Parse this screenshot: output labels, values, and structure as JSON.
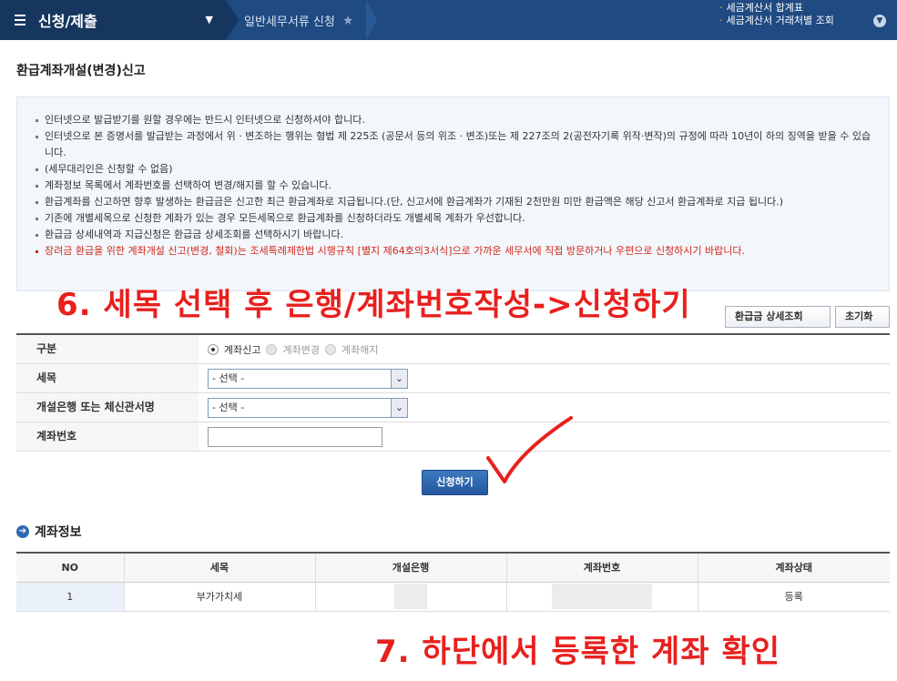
{
  "header": {
    "menu_title": "신청/제출",
    "breadcrumb": "일반세무서류 신청",
    "quicklinks": [
      "세금계산서 합계표",
      "세금계산서 거래처별 조회"
    ]
  },
  "page_title": "환급계좌개설(변경)신고",
  "notices": [
    {
      "text": "인터넷으로 발급받기를 원할 경우에는 반드시 인터넷으로 신청하셔야 합니다.",
      "red": false
    },
    {
      "text": "인터넷으로 본 증명서를 발급받는 과정에서 위 · 변조하는 행위는 형법 제 225조 (공문서 등의 위조 · 변조)또는 제 227조의 2(공전자기록 위작·변작)의 규정에 따라 10년이 하의 징역을 받을 수 있습니다.",
      "red": false
    },
    {
      "text": "(세무대리인은 신청할 수 없음)",
      "red": false
    },
    {
      "text": "계좌정보 목록에서 계좌번호를 선택하여 변경/해지를 할 수 있습니다.",
      "red": false
    },
    {
      "text": "환급계좌를 신고하면 향후 발생하는 환급금은 신고한 최근 환급계좌로 지급됩니다.(단, 신고서에 환급계좌가 기재된 2천만원 미만 환급액은 해당 신고서 환급계좌로 지급 됩니다.)",
      "red": false
    },
    {
      "text": "기존에 개별세목으로 신청한 계좌가 있는 경우 모든세목으로 환급계좌를 신청하더라도 개별세목 계좌가 우선합니다.",
      "red": false
    },
    {
      "text": "환급금 상세내역과 지급신청은 환급금 상세조회를 선택하시기 바랍니다.",
      "red": false
    },
    {
      "text": "장려금 환급을 위한 계좌개설 신고(변경, 철회)는 조세특례제한법 시행규칙 [별지 제64호의3서식]으로 가까운 세무서에 직접 방문하거나 우편으로 신청하시기 바랍니다.",
      "red": true
    }
  ],
  "annotations": {
    "step6": "6. 세목 선택 후 은행/계좌번호작성->신청하기",
    "step7": "7. 하단에서 등록한 계좌 확인"
  },
  "buttons": {
    "lookup": "환급금 상세조회",
    "reset": "초기화",
    "submit": "신청하기"
  },
  "form": {
    "type_label": "구분",
    "type_options": [
      {
        "label": "계좌신고",
        "selected": true,
        "disabled": false
      },
      {
        "label": "계좌변경",
        "selected": false,
        "disabled": true
      },
      {
        "label": "계좌해지",
        "selected": false,
        "disabled": true
      }
    ],
    "tax_label": "세목",
    "tax_value": "- 선택 -",
    "bank_label": "개설은행 또는 체신관서명",
    "bank_value": "- 선택 -",
    "account_label": "계좌번호",
    "account_value": ""
  },
  "account_section": {
    "title": "계좌정보",
    "columns": [
      "NO",
      "세목",
      "개설은행",
      "계좌번호",
      "계좌상태"
    ],
    "rows": [
      {
        "no": "1",
        "tax": "부가가치세",
        "bank": "",
        "account": "",
        "status": "등록"
      }
    ]
  },
  "colors": {
    "header_bg": "#1f4a82",
    "annotation_red": "#e8201e",
    "notice_red": "#d0291d",
    "submit_blue": "#2558a0"
  }
}
